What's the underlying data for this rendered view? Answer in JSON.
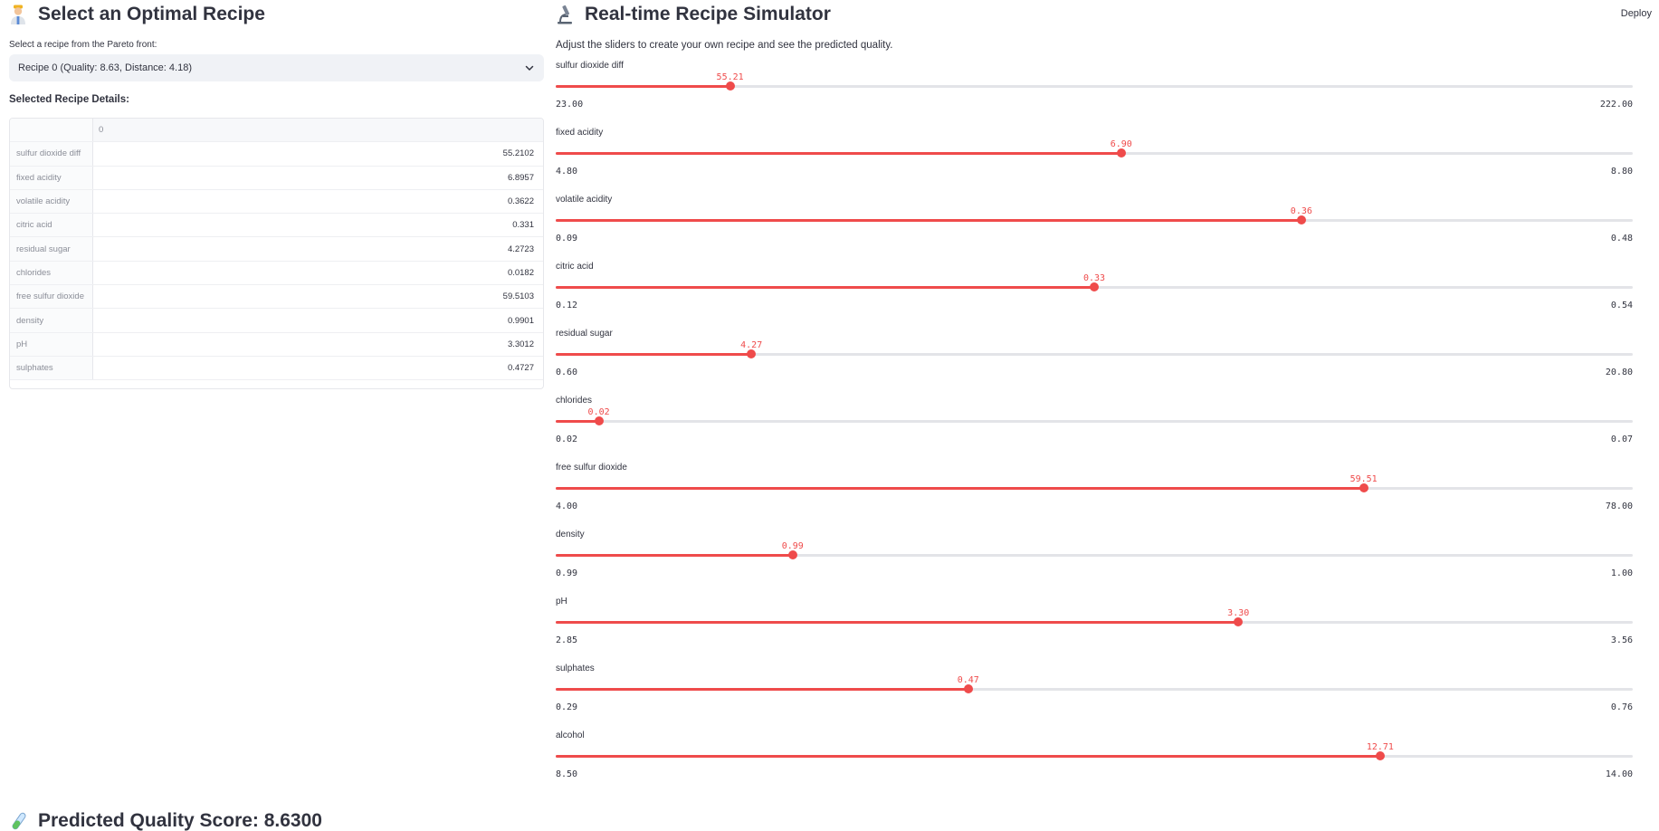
{
  "header": {
    "deploy_label": "Deploy"
  },
  "left": {
    "title": "Select an Optimal Recipe",
    "select_label": "Select a recipe from the Pareto front:",
    "selected_option": "Recipe 0 (Quality: 8.63, Distance: 4.18)",
    "details_title": "Selected Recipe Details:",
    "table": {
      "column_header": "0",
      "rows": [
        {
          "name": "sulfur dioxide diff",
          "value": "55.2102"
        },
        {
          "name": "fixed acidity",
          "value": "6.8957"
        },
        {
          "name": "volatile acidity",
          "value": "0.3622"
        },
        {
          "name": "citric acid",
          "value": "0.331"
        },
        {
          "name": "residual sugar",
          "value": "4.2723"
        },
        {
          "name": "chlorides",
          "value": "0.0182"
        },
        {
          "name": "free sulfur dioxide",
          "value": "59.5103"
        },
        {
          "name": "density",
          "value": "0.9901"
        },
        {
          "name": "pH",
          "value": "3.3012"
        },
        {
          "name": "sulphates",
          "value": "0.4727"
        }
      ]
    }
  },
  "right": {
    "title": "Real-time Recipe Simulator",
    "description": "Adjust the sliders to create your own recipe and see the predicted quality.",
    "sliders": [
      {
        "label": "sulfur dioxide diff",
        "value": 55.21,
        "value_text": "55.21",
        "min": 23.0,
        "max": 222.0,
        "min_text": "23.00",
        "max_text": "222.00"
      },
      {
        "label": "fixed acidity",
        "value": 6.9,
        "value_text": "6.90",
        "min": 4.8,
        "max": 8.8,
        "min_text": "4.80",
        "max_text": "8.80"
      },
      {
        "label": "volatile acidity",
        "value": 0.36,
        "value_text": "0.36",
        "min": 0.09,
        "max": 0.48,
        "min_text": "0.09",
        "max_text": "0.48"
      },
      {
        "label": "citric acid",
        "value": 0.33,
        "value_text": "0.33",
        "min": 0.12,
        "max": 0.54,
        "min_text": "0.12",
        "max_text": "0.54"
      },
      {
        "label": "residual sugar",
        "value": 4.27,
        "value_text": "4.27",
        "min": 0.6,
        "max": 20.8,
        "min_text": "0.60",
        "max_text": "20.80"
      },
      {
        "label": "chlorides",
        "value": 0.022,
        "value_text": "0.02",
        "min": 0.02,
        "max": 0.07,
        "min_text": "0.02",
        "max_text": "0.07"
      },
      {
        "label": "free sulfur dioxide",
        "value": 59.51,
        "value_text": "59.51",
        "min": 4.0,
        "max": 78.0,
        "min_text": "4.00",
        "max_text": "78.00"
      },
      {
        "label": "density",
        "value": 0.9922,
        "value_text": "0.99",
        "min": 0.99,
        "max": 1.0,
        "min_text": "0.99",
        "max_text": "1.00"
      },
      {
        "label": "pH",
        "value": 3.3,
        "value_text": "3.30",
        "min": 2.85,
        "max": 3.56,
        "min_text": "2.85",
        "max_text": "3.56"
      },
      {
        "label": "sulphates",
        "value": 0.47,
        "value_text": "0.47",
        "min": 0.29,
        "max": 0.76,
        "min_text": "0.29",
        "max_text": "0.76"
      },
      {
        "label": "alcohol",
        "value": 12.71,
        "value_text": "12.71",
        "min": 8.5,
        "max": 14.0,
        "min_text": "8.50",
        "max_text": "14.00"
      }
    ]
  },
  "bottom": {
    "title": "Predicted Quality Score: 8.6300"
  },
  "colors": {
    "accent": "#ef4b4b",
    "track": "#e3e4e8",
    "text": "#31333f",
    "select_bg": "#f0f2f6"
  },
  "icons": {
    "left_title": "scientist-icon",
    "right_title": "microscope-icon",
    "bottom_title": "test-tube-icon",
    "select": "chevron-down-icon"
  }
}
